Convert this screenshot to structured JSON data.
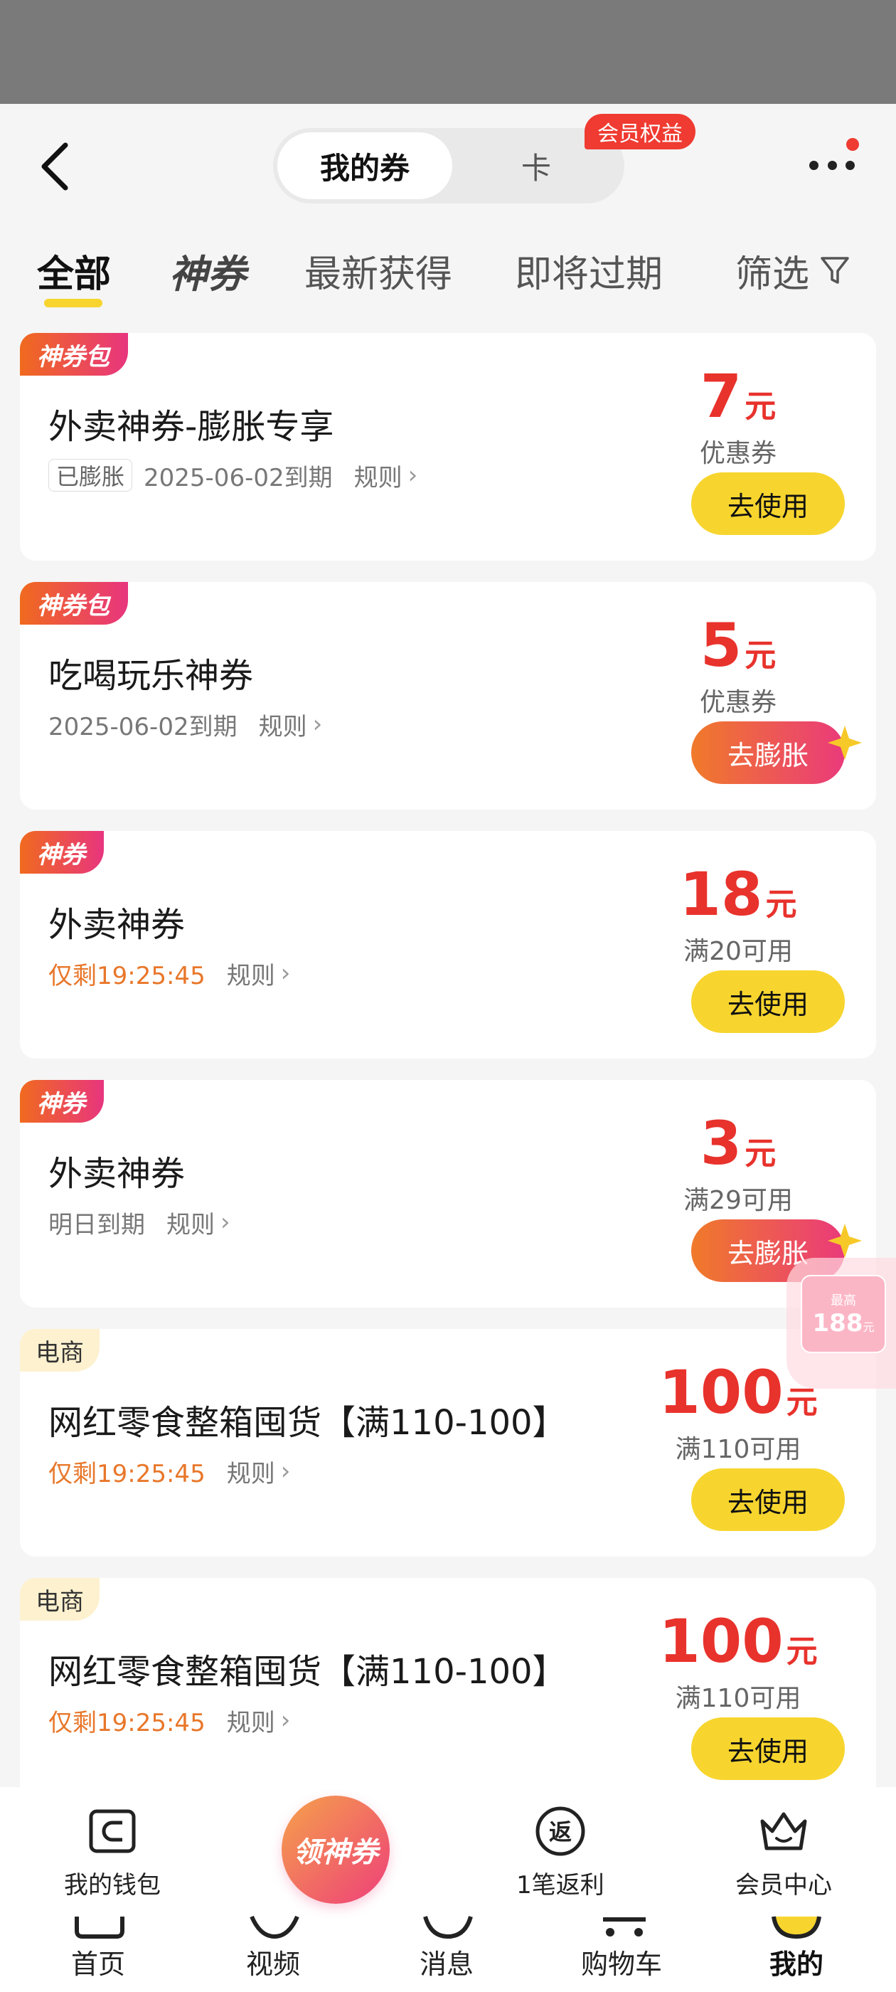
{
  "header": {
    "back_icon": "chevron-left-icon",
    "segment_active": "我的券",
    "segment_other": "卡",
    "member_badge": "会员权益",
    "more_icon": "more-dots-icon"
  },
  "tabs": [
    {
      "label": "全部",
      "active": true
    },
    {
      "label": "神券",
      "active": false
    },
    {
      "label": "最新获得",
      "active": false
    },
    {
      "label": "即将过期",
      "active": false
    },
    {
      "label": "筛选",
      "active": false,
      "icon": "filter-icon"
    }
  ],
  "coupons": [
    {
      "tag": "神券包",
      "title": "外卖神券-膨胀专享",
      "chip": "已膨胀",
      "expiry": "2025-06-02到期",
      "rule": "规则",
      "amount": "7",
      "unit": "元",
      "condition": "优惠券",
      "button": "去使用"
    },
    {
      "tag": "神券包",
      "title": "吃喝玩乐神券",
      "expiry": "2025-06-02到期",
      "rule": "规则",
      "amount": "5",
      "unit": "元",
      "condition": "优惠券",
      "button": "去膨胀"
    },
    {
      "tag": "神券",
      "title": "外卖神券",
      "countdown": "仅剩19:25:45",
      "rule": "规则",
      "amount": "18",
      "unit": "元",
      "condition": "满20可用",
      "button": "去使用"
    },
    {
      "tag": "神券",
      "title": "外卖神券",
      "expiry": "明日到期",
      "rule": "规则",
      "amount": "3",
      "unit": "元",
      "condition": "满29可用",
      "button": "去膨胀"
    },
    {
      "tag": "电商",
      "title": "网红零食整箱囤货【满110-100】",
      "countdown": "仅剩19:25:45",
      "rule": "规则",
      "amount": "100",
      "unit": "元",
      "condition": "满110可用",
      "button": "去使用"
    },
    {
      "tag": "电商",
      "title": "网红零食整箱囤货【满110-100】",
      "countdown": "仅剩19:25:45",
      "rule": "规则",
      "amount": "100",
      "unit": "元",
      "condition": "满110可用",
      "button": "去使用"
    }
  ],
  "float_ad": {
    "small": "最高",
    "amount": "188",
    "unit": "元"
  },
  "dock": {
    "wallet": "我的钱包",
    "claim": "领神券",
    "rebate": "1笔返利",
    "rebate_icon_char": "返",
    "member": "会员中心"
  },
  "nav": [
    {
      "label": "首页"
    },
    {
      "label": "视频"
    },
    {
      "label": "消息"
    },
    {
      "label": "购物车"
    },
    {
      "label": "我的"
    }
  ],
  "colors": {
    "accent_yellow": "#f7d52e",
    "price_red": "#e8322c",
    "gradient_start": "#f07a2a",
    "gradient_end": "#ea3a7b",
    "countdown_orange": "#e8772a"
  }
}
